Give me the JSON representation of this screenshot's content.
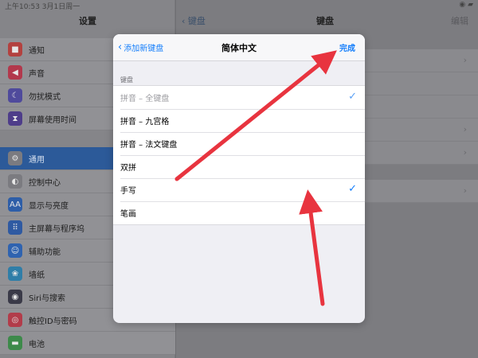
{
  "status": {
    "time": "上午10:53  3月1日周一",
    "right": "◉ ▰"
  },
  "sidebar": {
    "title": "设置",
    "groups": [
      [
        {
          "label": "通知",
          "icon": "notifications-icon",
          "color": "#b3413f",
          "glyph": "■"
        },
        {
          "label": "声音",
          "icon": "sound-icon",
          "color": "#b2384c",
          "glyph": "◀"
        },
        {
          "label": "勿扰模式",
          "icon": "moon-icon",
          "color": "#4f4a9c",
          "glyph": "☾"
        },
        {
          "label": "屏幕使用时间",
          "icon": "hourglass-icon",
          "color": "#4e3d8a",
          "glyph": "⧗"
        }
      ],
      [
        {
          "label": "通用",
          "icon": "gear-icon",
          "color": "#7b7b80",
          "glyph": "⚙",
          "selected": true
        },
        {
          "label": "控制中心",
          "icon": "control-center-icon",
          "color": "#7b7b80",
          "glyph": "◐"
        },
        {
          "label": "显示与亮度",
          "icon": "display-icon",
          "color": "#2e5ea8",
          "glyph": "AA"
        },
        {
          "label": "主屏幕与程序坞",
          "icon": "home-screen-icon",
          "color": "#2f5aa2",
          "glyph": "⠿"
        },
        {
          "label": "辅助功能",
          "icon": "accessibility-icon",
          "color": "#2f63b0",
          "glyph": "☺"
        },
        {
          "label": "墙纸",
          "icon": "wallpaper-icon",
          "color": "#2f7ea8",
          "glyph": "❀"
        },
        {
          "label": "Siri与搜索",
          "icon": "siri-icon",
          "color": "#3a3a48",
          "glyph": "◉"
        },
        {
          "label": "触控ID与密码",
          "icon": "touch-id-icon",
          "color": "#b23c4a",
          "glyph": "◎"
        },
        {
          "label": "电池",
          "icon": "battery-icon",
          "color": "#3d8a4a",
          "glyph": "▬"
        }
      ]
    ]
  },
  "detail": {
    "back_label": "键盘",
    "title": "键盘",
    "edit_label": "编辑"
  },
  "modal": {
    "back_label": "添加新键盘",
    "title": "简体中文",
    "done_label": "完成",
    "section_header": "键盘",
    "items": [
      {
        "label": "拼音 – 全键盘",
        "checked": true,
        "disabled": true
      },
      {
        "label": "拼音 – 九宫格",
        "checked": false,
        "disabled": false
      },
      {
        "label": "拼音 – 法文键盘",
        "checked": false,
        "disabled": false
      },
      {
        "label": "双拼",
        "checked": false,
        "disabled": false
      },
      {
        "label": "手写",
        "checked": true,
        "disabled": false
      },
      {
        "label": "笔画",
        "checked": false,
        "disabled": false
      }
    ],
    "checkmark": "✓"
  },
  "colors": {
    "accent": "#147efb",
    "arrow": "#e8343f",
    "selected": "#2c5a99"
  }
}
